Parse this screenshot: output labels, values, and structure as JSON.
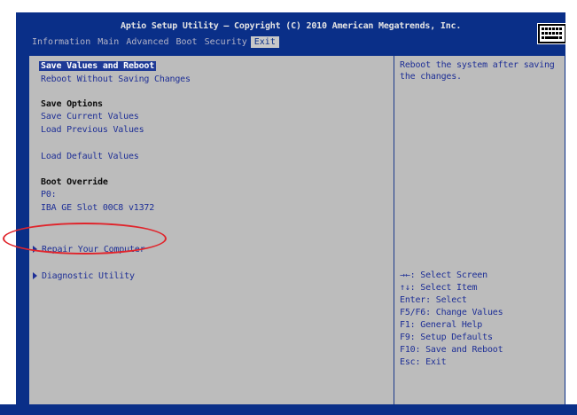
{
  "header": {
    "title": "Aptio Setup Utility – Copyright (C) 2010 American Megatrends, Inc.",
    "tabs": [
      "Information",
      "Main",
      "Advanced",
      "Boot",
      "Security",
      "Exit"
    ],
    "active_tab": "Exit"
  },
  "menu": {
    "save_values_and_reboot": "Save Values and Reboot",
    "reboot_without_saving": "Reboot Without Saving Changes",
    "save_options_header": "Save Options",
    "save_current_values": "Save Current Values",
    "load_previous_values": "Load Previous Values",
    "load_default_values": "Load Default Values",
    "boot_override_header": "Boot Override",
    "p0": "P0:",
    "iba_ge_slot": "IBA GE Slot 00C8 v1372",
    "repair_your_computer": "Repair Your Computer",
    "diagnostic_utility": "Diagnostic Utility"
  },
  "description": "Reboot the system after saving the changes.",
  "help": [
    "→←: Select Screen",
    "↑↓: Select Item",
    "Enter: Select",
    "F5/F6: Change Values",
    "F1: General Help",
    "F9: Setup Defaults",
    "F10: Save and Reboot",
    "Esc: Exit"
  ],
  "colors": {
    "frame": "#0a2f88",
    "panel": "#bcbcbc",
    "link_text": "#1e2f96",
    "selection": "#1e3a96",
    "annotation_circle": "#e0242b"
  },
  "icons": {
    "keyboard": "keyboard-icon",
    "submenu": "triangle-right-icon"
  }
}
